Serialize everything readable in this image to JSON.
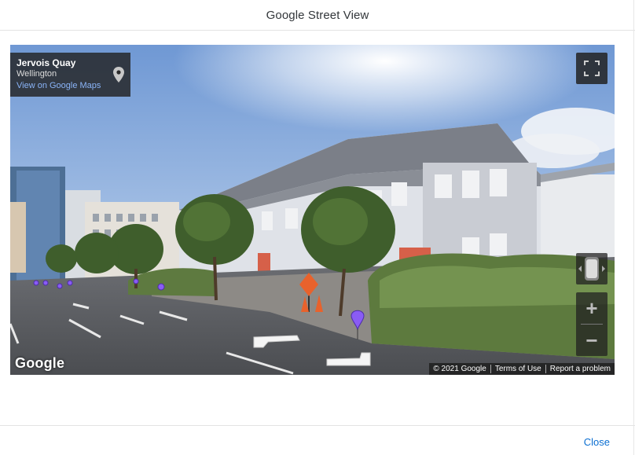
{
  "dialog": {
    "title": "Google Street View",
    "close_label": "Close"
  },
  "street_view": {
    "location_name": "Jervois Quay",
    "location_city": "Wellington",
    "maps_link": "View on Google Maps",
    "logo_text": "Google",
    "attribution": {
      "copyright": "© 2021 Google",
      "terms": "Terms of Use",
      "report": "Report a problem"
    },
    "controls": {
      "fullscreen_icon": "fullscreen-icon",
      "pegman_icon": "pegman-icon",
      "zoom_in_label": "+",
      "zoom_out_label": "−"
    }
  },
  "colors": {
    "link_blue": "#0a6ed1",
    "maps_link_blue": "#8ab4f8",
    "nav_pin_purple": "#8a5cf5"
  }
}
